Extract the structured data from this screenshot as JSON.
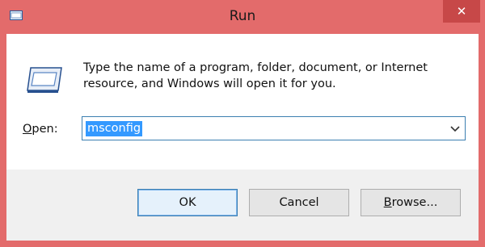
{
  "window": {
    "title": "Run",
    "close_glyph": "✕"
  },
  "body": {
    "description": "Type the name of a program, folder, document, or Internet resource, and Windows will open it for you.",
    "open_label_underlined": "O",
    "open_label_rest": "pen:",
    "open_value": "msconfig"
  },
  "buttons": {
    "ok_label": "OK",
    "cancel_label": "Cancel",
    "browse_label_underlined": "B",
    "browse_label_rest": "rowse..."
  },
  "icons": {
    "app": "run-icon",
    "big": "run-large-icon",
    "close": "close-icon",
    "dropdown": "chevron-down-icon"
  },
  "colors": {
    "titlebar": "#e36b6b",
    "close_button": "#c74848",
    "selection": "#3399ff",
    "focus_border": "#3c7fb1"
  }
}
